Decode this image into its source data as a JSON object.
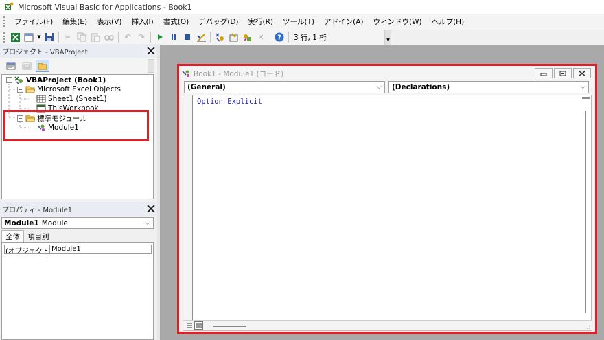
{
  "window": {
    "title": "Microsoft Visual Basic for Applications - Book1"
  },
  "menu": [
    "ファイル(F)",
    "編集(E)",
    "表示(V)",
    "挿入(I)",
    "書式(O)",
    "デバッグ(D)",
    "実行(R)",
    "ツール(T)",
    "アドイン(A)",
    "ウィンドウ(W)",
    "ヘルプ(H)"
  ],
  "toolbar": {
    "cursor_position": "3 行, 1 桁"
  },
  "project_panel": {
    "title": "プロジェクト - VBAProject",
    "tree": {
      "root": "VBAProject (Book1)",
      "excel_objects": "Microsoft Excel Objects",
      "sheet1": "Sheet1 (Sheet1)",
      "thisworkbook": "ThisWorkbook",
      "modules_folder": "標準モジュール",
      "module1": "Module1"
    }
  },
  "properties_panel": {
    "title": "プロパティ - Module1",
    "object_name": "Module1",
    "object_type": "Module",
    "tabs": [
      "全体",
      "項目別"
    ],
    "rows": [
      {
        "name": "(オブジェクト名)",
        "value": "Module1"
      }
    ]
  },
  "code_window": {
    "title": "Book1 - Module1 (コード)",
    "object_combo": "(General)",
    "procedure_combo": "(Declarations)",
    "code": "Option Explicit"
  },
  "colors": {
    "highlight": "#e01f27",
    "code_keyword": "#1c1cab"
  }
}
